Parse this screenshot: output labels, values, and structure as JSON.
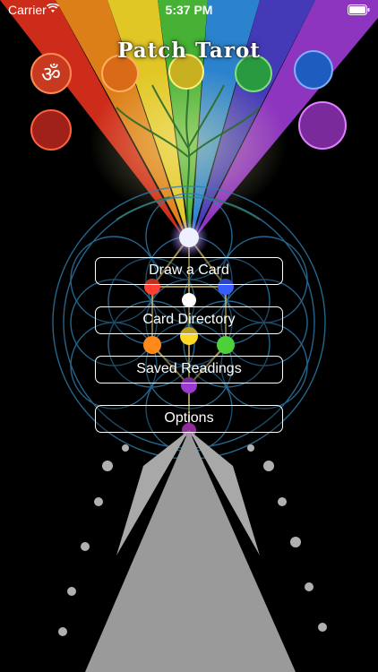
{
  "status_bar": {
    "carrier": "Carrier",
    "time": "5:37 PM",
    "wifi_icon": "wifi-icon",
    "battery_icon": "battery-full-icon"
  },
  "app": {
    "title": "Patch Tarot"
  },
  "menu": {
    "items": [
      {
        "label": "Draw a Card"
      },
      {
        "label": "Card Directory"
      },
      {
        "label": "Saved Readings"
      },
      {
        "label": "Options"
      }
    ]
  },
  "background": {
    "description_icons": [
      "chakra-symbol-icon",
      "flower-of-life-icon",
      "tree-of-life-icon"
    ],
    "colors": {
      "red": "#e0301e",
      "orange": "#f08a1c",
      "yellow": "#f5d82a",
      "green": "#4cc13a",
      "blue": "#2f8fe0",
      "indigo": "#4a3fc8",
      "violet": "#9a3ad0",
      "geometry": "#2f7fb0",
      "cone": "#9a9a9a"
    }
  }
}
